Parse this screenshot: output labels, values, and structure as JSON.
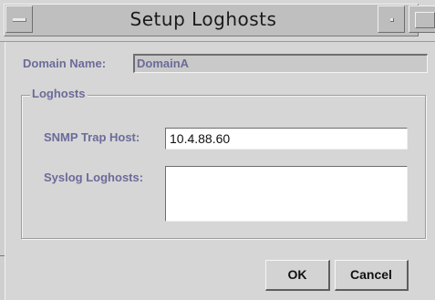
{
  "window": {
    "title": "Setup Loghosts"
  },
  "form": {
    "domain_label": "Domain Name:",
    "domain_value": "DomainA",
    "group_title": "Loghosts",
    "snmp_label": "SNMP Trap Host:",
    "snmp_value": "10.4.88.60",
    "syslog_label": "Syslog Loghosts:",
    "syslog_value": ""
  },
  "buttons": {
    "ok_label": "OK",
    "cancel_label": "Cancel"
  },
  "colors": {
    "label_text": "#6b6b9a",
    "background": "#d6d6d6"
  }
}
